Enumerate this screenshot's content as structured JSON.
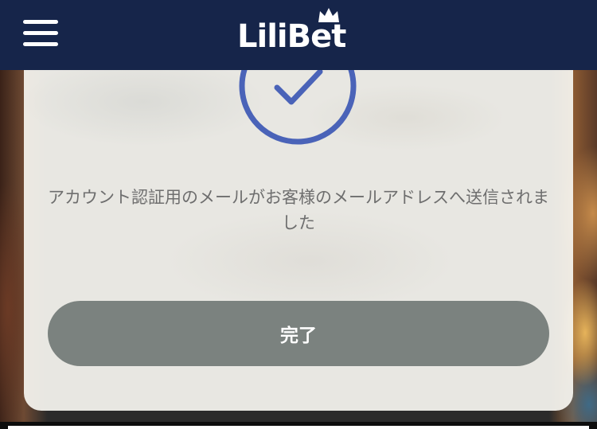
{
  "header": {
    "logo_text": "LiliBet",
    "menu_icon": "hamburger-menu-icon",
    "logo_icon": "crown-icon",
    "background_color": "#16254a"
  },
  "modal": {
    "status_icon": "checkmark-circle-icon",
    "message": "アカウント認証用のメールがお客様のメールアドレスへ送信されました",
    "done_label": "完了",
    "accent_color": "#4a63b8",
    "button_color": "#7b827f"
  }
}
